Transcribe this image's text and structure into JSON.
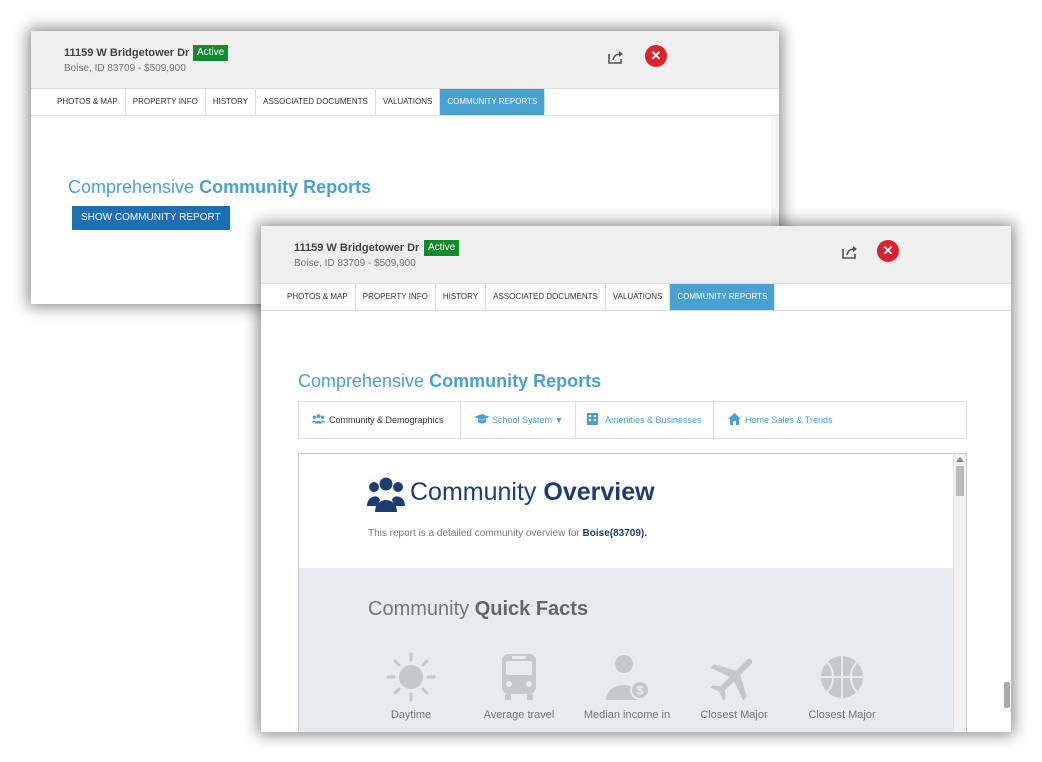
{
  "listing": {
    "address": "11159 W Bridgetower Dr",
    "status": "Active",
    "subtitle": "Boise, ID 83709 - $509,900"
  },
  "tabs": [
    {
      "label": "PHOTOS & MAP"
    },
    {
      "label": "PROPERTY INFO"
    },
    {
      "label": "HISTORY"
    },
    {
      "label": "ASSOCIATED DOCUMENTS"
    },
    {
      "label": "VALUATIONS"
    },
    {
      "label": "COMMUNITY REPORTS",
      "active": true
    }
  ],
  "heading": {
    "light": "Comprehensive",
    "bold": "Community Reports"
  },
  "show_report_button": "SHOW COMMUNITY REPORT",
  "subnav": [
    {
      "label": "Community & Demographics",
      "icon": "users-icon"
    },
    {
      "label": "School System ▼",
      "icon": "graduation-cap-icon"
    },
    {
      "label": "Amenities & Businesses",
      "icon": "building-icon"
    },
    {
      "label": "Home Sales & Trends",
      "icon": "home-icon"
    }
  ],
  "overview": {
    "title_light": "Community",
    "title_bold": "Overview",
    "description": "This report is a detailed community overview for",
    "location": "Boise(83709)."
  },
  "quick_facts": {
    "title_light": "Community",
    "title_bold": "Quick Facts",
    "items": [
      {
        "label": "Daytime",
        "icon": "sun-icon"
      },
      {
        "label": "Average travel",
        "icon": "bus-icon"
      },
      {
        "label": "Median income in",
        "icon": "income-icon"
      },
      {
        "label": "Closest Major",
        "icon": "airplane-icon"
      },
      {
        "label": "Closest Major",
        "icon": "basketball-icon"
      }
    ]
  },
  "colors": {
    "accent": "#4aa0cf",
    "status_green": "#148a2e",
    "close_red": "#d9232f",
    "navy": "#1d3d72"
  }
}
